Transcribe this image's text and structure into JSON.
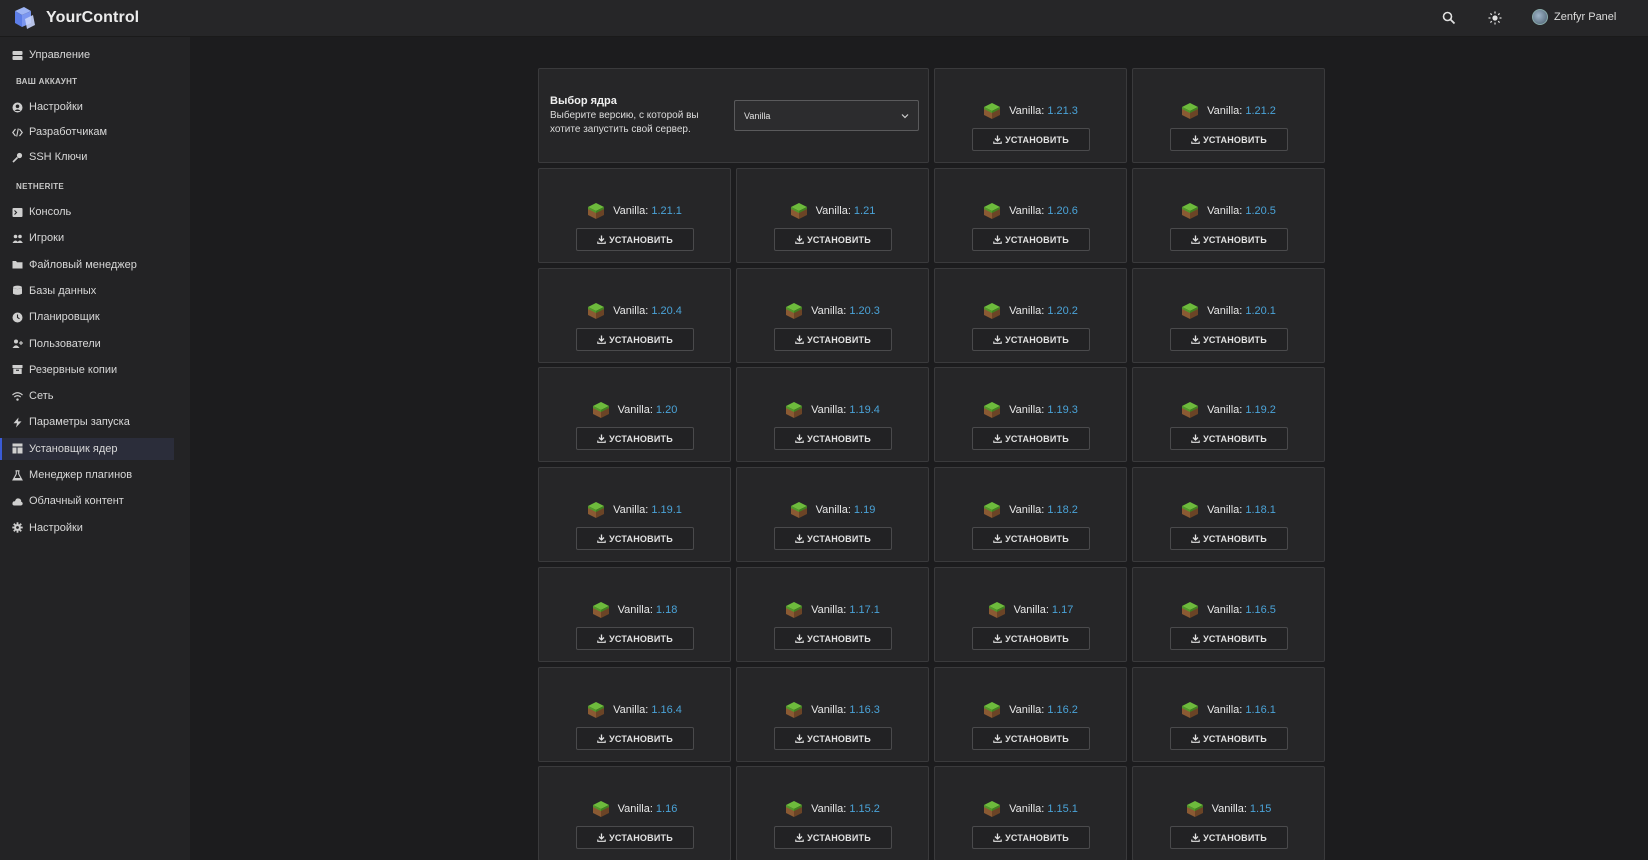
{
  "header": {
    "brand": "YourControl",
    "user_name": "Zenfyr Panel"
  },
  "sidebar": {
    "top_item": "Управление",
    "section_account": "ВАШ АККАУНТ",
    "account_items": [
      "Настройки",
      "Разработчикам",
      "SSH Ключи"
    ],
    "section_server": "NETHERITE",
    "server_items": [
      "Консоль",
      "Игроки",
      "Файловый менеджер",
      "Базы данных",
      "Планировщик",
      "Пользователи",
      "Резервные копии",
      "Сеть",
      "Параметры запуска",
      "Установщик ядер",
      "Менеджер плагинов",
      "Облачный контент",
      "Настройки"
    ],
    "active_item": "Установщик ядер"
  },
  "core_picker": {
    "title": "Выбор ядра",
    "description": "Выберите версию, с которой вы хотите запустить свой сервер.",
    "selected": "Vanilla"
  },
  "install_label": "УСТАНОВИТЬ",
  "core_name": "Vanilla:",
  "versions": [
    "1.21.3",
    "1.21.2",
    "1.21.1",
    "1.21",
    "1.20.6",
    "1.20.5",
    "1.20.4",
    "1.20.3",
    "1.20.2",
    "1.20.1",
    "1.20",
    "1.19.4",
    "1.19.3",
    "1.19.2",
    "1.19.1",
    "1.19",
    "1.18.2",
    "1.18.1",
    "1.18",
    "1.17.1",
    "1.17",
    "1.16.5",
    "1.16.4",
    "1.16.3",
    "1.16.2",
    "1.16.1",
    "1.16",
    "1.15.2",
    "1.15.1",
    "1.15"
  ],
  "colors": {
    "accent": "#3a5bd9",
    "version": "#4aa3d8",
    "background": "#1c1c1e",
    "card": "#262628"
  }
}
